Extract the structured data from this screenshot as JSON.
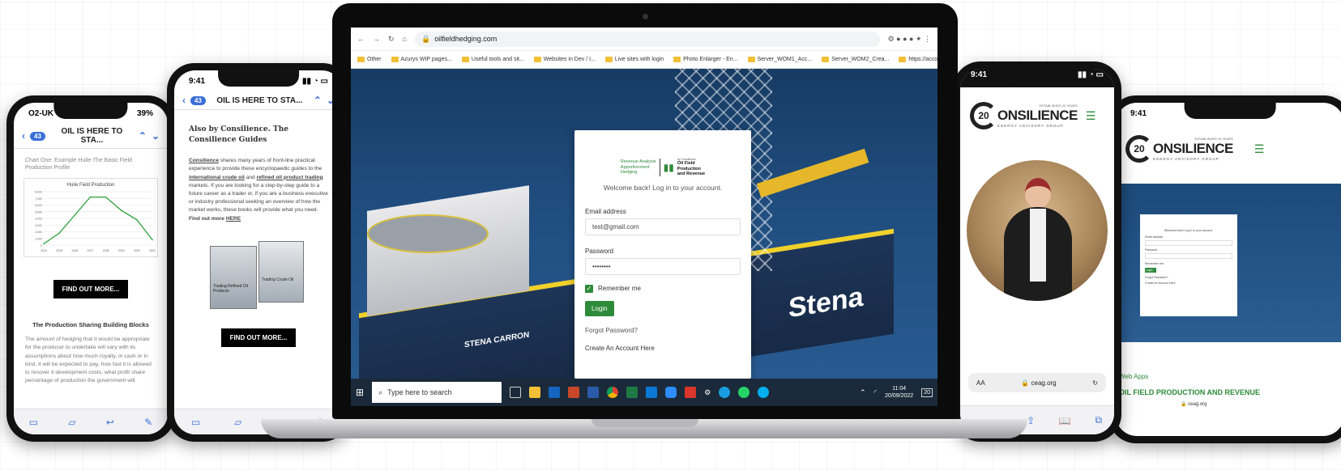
{
  "phone1": {
    "status": {
      "carrier": "O2-UK",
      "battery": "39%"
    },
    "nav": {
      "badge": "43",
      "title": "OIL IS HERE TO STA..."
    },
    "chart_caption": "Chart One: Example Huile-The Basic Field Production Profile",
    "cta": "FIND OUT MORE...",
    "section_title": "The Production Sharing Building Blocks",
    "body": "The amount of hedging that it would be appropriate for the producer to undertake will vary with its assumptions about how much royalty, in cash or in kind, it will be expected to pay, how fast it is allowed to recover it development costs, what profit share percentage of production the government will"
  },
  "chart_data": {
    "type": "line",
    "title": "Huile Field Production",
    "xlabel": "",
    "ylabel": "",
    "categories": [
      "2024",
      "2025",
      "2026",
      "2027",
      "2028",
      "2029",
      "2030",
      "2031"
    ],
    "values": [
      200,
      1800,
      4500,
      7200,
      7200,
      5200,
      3800,
      800
    ],
    "ylim": [
      0,
      8000
    ],
    "yticks": [
      "0",
      "1,000",
      "2,000",
      "3,000",
      "4,000",
      "5,000",
      "6,000",
      "7,000",
      "8,000"
    ],
    "grid": true,
    "color": "#2e9e3a"
  },
  "phone2": {
    "time": "9:41",
    "nav": {
      "badge": "43",
      "title": "OIL IS HERE TO STA..."
    },
    "heading": "Also by Consilience. The Consilience Guides",
    "para_a": "Consilience",
    "para_b": " shares many years of front-line practical experience to provide these encyclopaedic guides to the ",
    "para_c": "international crude oil",
    "para_d": " and ",
    "para_e": "refined oil product trading",
    "para_f": " markets. If you are looking for a step-by-step guide to a future career as a trader or, if you are a business executive or industry professional seeking an overview of how the market works, these books will provide what you need. ",
    "para_g": "Find out more",
    "para_h": "HERE",
    "book1": "Trading Refined Oil Products",
    "book2": "Trading Crude Oil",
    "cta": "FIND OUT MORE..."
  },
  "laptop": {
    "url": "oilfieldhedging.com",
    "bookmarks": [
      "Other",
      "Azurys WIP pages...",
      "Useful tools and sit...",
      "Websites in Dev / I...",
      "Live sites with login",
      "Photo Enlarger - En...",
      "Server_WOM1_Acc...",
      "Server_WOM2_Crea...",
      "https://accounts.zo..."
    ],
    "login": {
      "logo_left": [
        "Revenue Analysis",
        "Apportionment",
        "Hedging"
      ],
      "logo_right": [
        "Oil Field",
        "Production",
        "and Revenue"
      ],
      "logo_small": "by Consilience",
      "welcome": "Welcome back! Log in to your account.",
      "email_label": "Email address",
      "email_value": "test@gmail.com",
      "password_label": "Password",
      "password_value": "••••••••",
      "remember": "Remember me",
      "login_btn": "Login",
      "forgot": "Forgot Password?",
      "create": "Create An Account Here"
    },
    "ship_name": "STENA CARRON",
    "hull_text": "Stena",
    "taskbar": {
      "search": "Type here to search",
      "time": "11:04",
      "date": "20/09/2022",
      "notif": "20"
    }
  },
  "phone3": {
    "time": "9:41",
    "logo_main": "ONSILIENCE",
    "logo_num": "20",
    "logo_sub": "ENERGY ADVISORY GROUP",
    "logo_est": "ESTABLISHED 20 YEARS",
    "address_aa": "AA",
    "address": "ceag.org"
  },
  "phone4": {
    "time": "9:41",
    "logo_main": "ONSILIENCE",
    "logo_num": "20",
    "logo_sub": "ENERGY ADVISORY GROUP",
    "logo_est": "ESTABLISHED 20 YEARS",
    "web_apps": "Web Apps",
    "headline": "OIL FIELD PRODUCTION AND REVENUE",
    "address": "ceag.org",
    "mini": {
      "email_label": "Email address",
      "password_label": "Password",
      "remember": "Remember me",
      "login": "Login",
      "forgot": "Forgot Password?",
      "create": "Create An Account Here",
      "welcome": "Welcome back! Log in to your account."
    }
  }
}
